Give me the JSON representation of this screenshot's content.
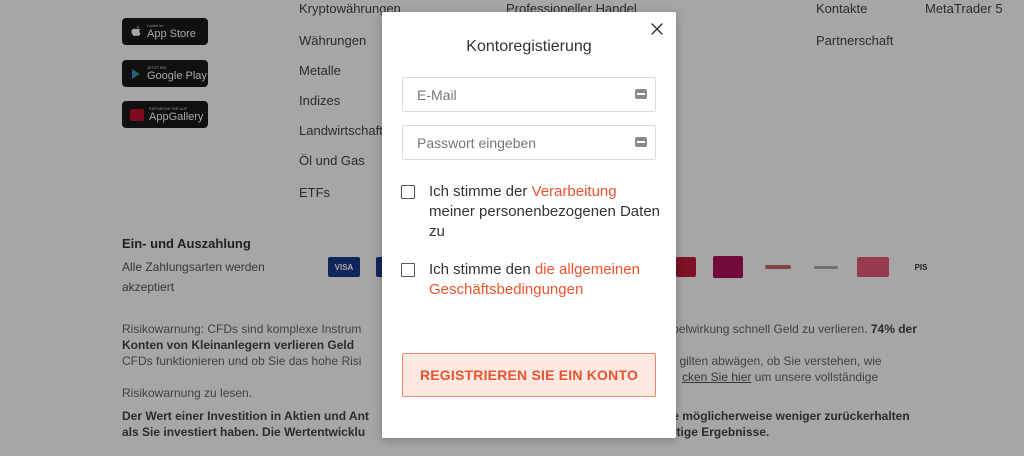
{
  "background": {
    "stores": [
      {
        "small": "Laden im",
        "big": "App Store"
      },
      {
        "small": "JETZT BEI",
        "big": "Google Play"
      },
      {
        "small": "ENTDECKE SIE AUF",
        "big": "AppGallery"
      }
    ],
    "nav_col1": [
      "Kryptowährungen",
      "Währungen",
      "Metalle",
      "Indizes",
      "Landwirtschaft",
      "Öl und Gas",
      "ETFs"
    ],
    "nav_col2": [
      "Professioneller Handel"
    ],
    "nav_col3": [
      "Kontakte",
      "Partnerschaft"
    ],
    "nav_col4": [
      "MetaTrader 5"
    ],
    "payment": {
      "title": "Ein- und Auszahlung",
      "subtitle": "Alle Zahlungsarten werden akzeptiert",
      "icons": [
        "VISA",
        "",
        "",
        "",
        "",
        "",
        "",
        "PIS"
      ]
    },
    "risk": {
      "part1": "Risikowarnung: CFDs sind komplexe Instrum",
      "part1b": "ebelwirkung schnell Geld zu verlieren.",
      "bold1": " 74% der Konten von Kleinanlegern verlieren Geld",
      "part2": " CFDs funktionieren und ob Sie das hohe Risi",
      "part2b": "gilten abwägen, ob Sie verstehen, wie",
      "link": "cken Sie hier",
      "part3": " um unsere vollständige Risikowarnung zu lesen."
    },
    "investment_line1": "Der Wert einer Investition in Aktien und Ant",
    "investment_line1b": "ie möglicherweise weniger zurückerhalten",
    "investment_line2": "als Sie investiert haben. Die Wertentwicklu",
    "investment_line2b": "nftige Ergebnisse."
  },
  "modal": {
    "title": "Kontoregistierung",
    "email_placeholder": "E-Mail",
    "password_placeholder": "Passwort eingeben",
    "consent1_prefix": "Ich stimme der ",
    "consent1_link": "Verarbeitung",
    "consent1_suffix": " meiner personenbezogenen Daten zu",
    "consent2_prefix": "Ich stimme den ",
    "consent2_link": "die allgemeinen Geschäftsbedingungen",
    "register_label": "REGISTRIEREN SIE EIN KONTO"
  },
  "colors": {
    "accent": "#e8552e",
    "button_bg": "#fde8e2",
    "button_border": "#ee8a6c",
    "overlay": "rgba(0,0,0,0.35)"
  },
  "icons": {
    "close": "close-icon",
    "key": "key-icon"
  }
}
